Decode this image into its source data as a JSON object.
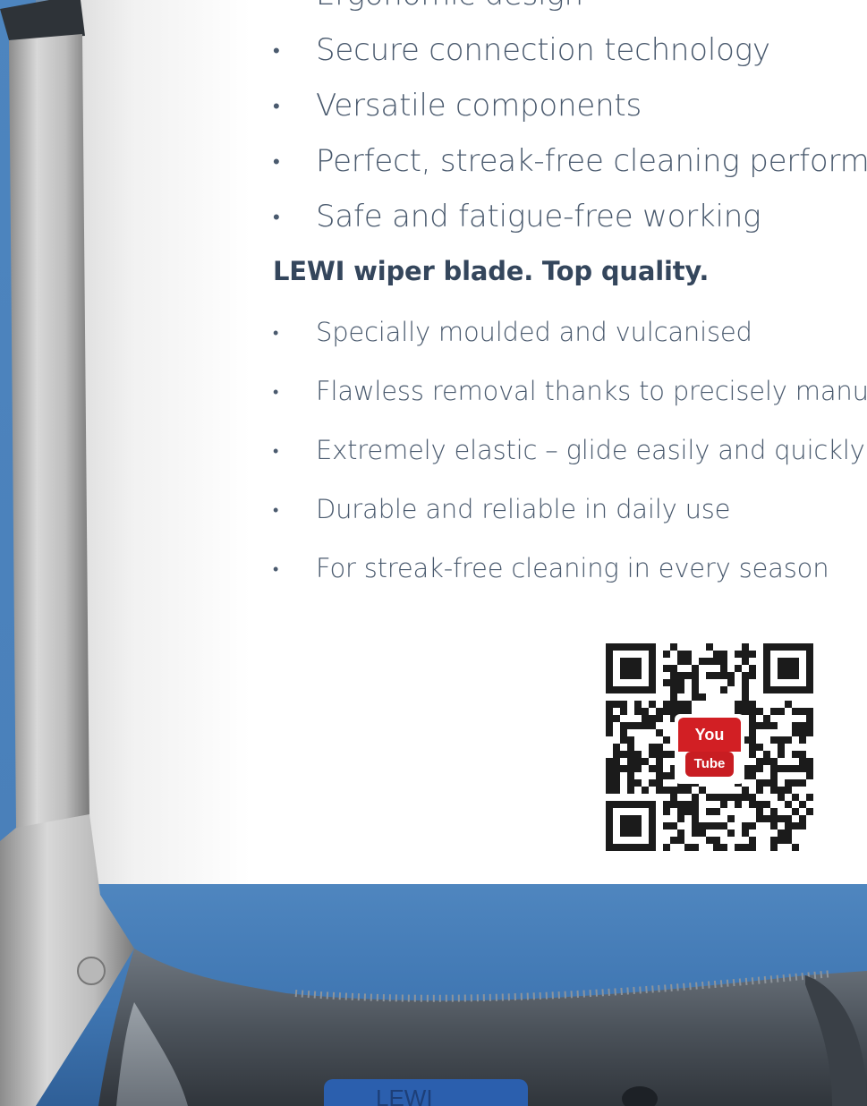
{
  "features": {
    "items": [
      "Ergonomic design",
      "Secure connection technology",
      "Versatile components",
      "Perfect, streak-free cleaning performance",
      "Safe and fatigue-free working"
    ]
  },
  "wiper_blade": {
    "heading": "LEWI wiper blade. Top quality.",
    "items": [
      "Specially moulded and vulcanised",
      "Flawless removal thanks to precisely manufactured edges",
      "Extremely elastic – glide easily and quickly",
      "Durable and reliable in daily use",
      "For streak-free cleaning in every season"
    ]
  },
  "qr_code": {
    "badge_top": "You",
    "badge_bottom": "Tube"
  },
  "colors": {
    "brand_blue": "#4a80ba",
    "text": "#4a5a6e",
    "heading": "#34465c",
    "youtube_red": "#d21f24"
  }
}
